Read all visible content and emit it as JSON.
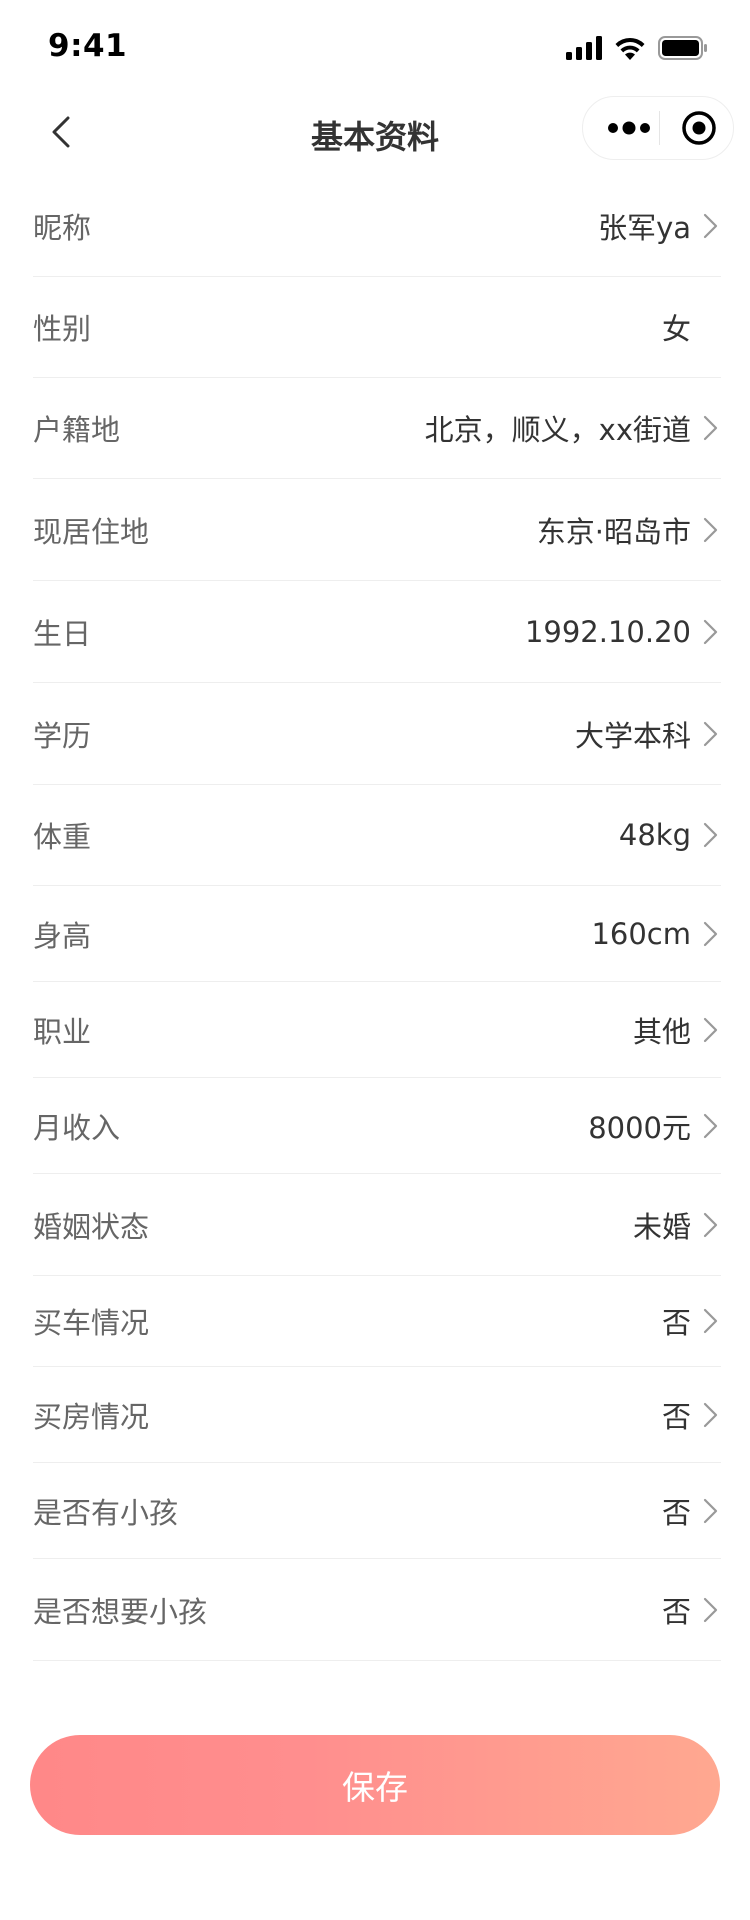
{
  "status_bar": {
    "time": "9:41",
    "icons": [
      "signal-icon",
      "wifi-icon",
      "battery-icon"
    ]
  },
  "nav": {
    "title": "基本资料",
    "back_icon": "chevron-left-icon",
    "capsule_icons": [
      "more-icon",
      "close-circle-icon"
    ]
  },
  "form": {
    "rows": [
      {
        "label": "昵称",
        "value": "张军ya",
        "has_arrow": true
      },
      {
        "label": "性别",
        "value": "女",
        "has_arrow": false
      },
      {
        "label": "户籍地",
        "value": "北京，顺义，xx街道",
        "has_arrow": true
      },
      {
        "label": "现居住地",
        "value": "东京·昭岛市",
        "has_arrow": true
      },
      {
        "label": "生日",
        "value": "1992.10.20",
        "has_arrow": true
      },
      {
        "label": "学历",
        "value": "大学本科",
        "has_arrow": true
      },
      {
        "label": "体重",
        "value": "48kg",
        "has_arrow": true
      },
      {
        "label": "身高",
        "value": "160cm",
        "has_arrow": true
      },
      {
        "label": "职业",
        "value": "其他",
        "has_arrow": true
      },
      {
        "label": "月收入",
        "value": "8000元",
        "has_arrow": true
      },
      {
        "label": "婚姻状态",
        "value": "未婚",
        "has_arrow": true
      },
      {
        "label": "买车情况",
        "value": "否",
        "has_arrow": true
      },
      {
        "label": "买房情况",
        "value": "否",
        "has_arrow": true
      },
      {
        "label": "是否有小孩",
        "value": "否",
        "has_arrow": true
      },
      {
        "label": "是否想要小孩",
        "value": "否",
        "has_arrow": true
      }
    ]
  },
  "save_button": {
    "label": "保存"
  },
  "colors": {
    "accent_start": "#FF8888",
    "accent_end": "#FFA890",
    "label": "#666666",
    "value": "#333333",
    "divider": "#EEEEEE"
  }
}
